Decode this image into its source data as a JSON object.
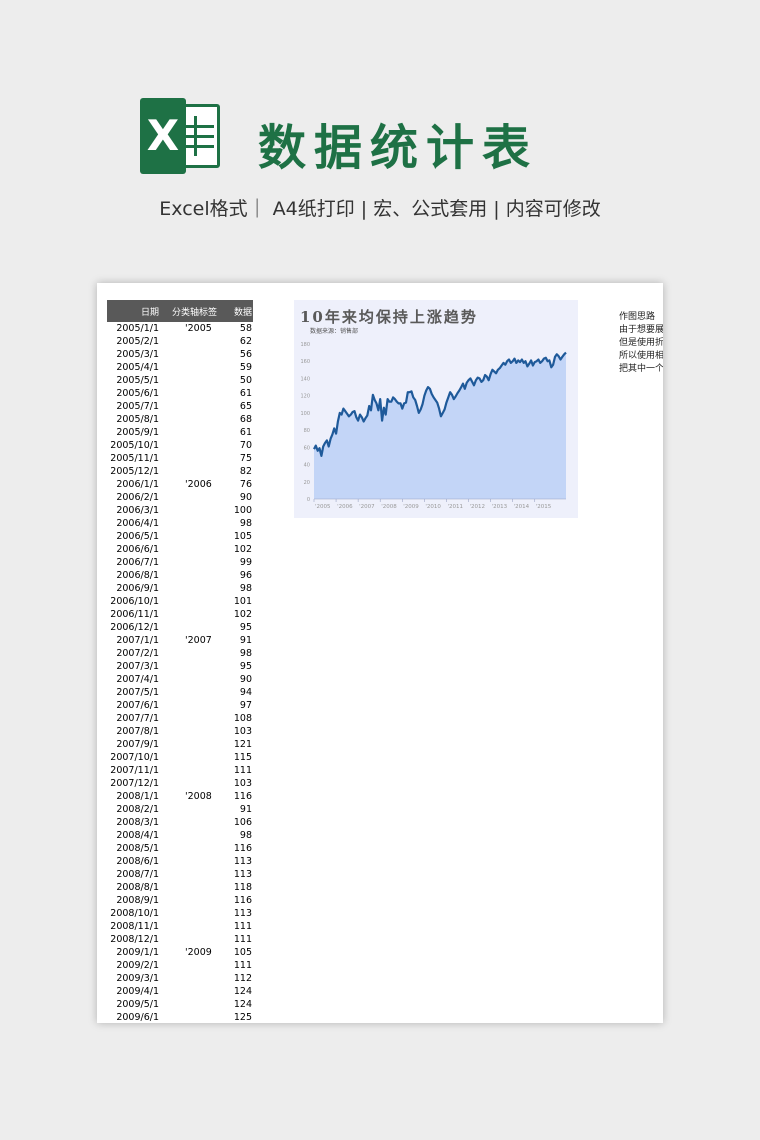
{
  "header": {
    "logo_letter": "X",
    "title": "数据统计表",
    "subtitle": "Excel格式｜ A4纸打印 | 宏、公式套用 | 内容可修改"
  },
  "table": {
    "headers": [
      "日期",
      "分类轴标签",
      "数据"
    ],
    "rows": [
      [
        "2005/1/1",
        "'2005",
        "58"
      ],
      [
        "2005/2/1",
        "",
        "62"
      ],
      [
        "2005/3/1",
        "",
        "56"
      ],
      [
        "2005/4/1",
        "",
        "59"
      ],
      [
        "2005/5/1",
        "",
        "50"
      ],
      [
        "2005/6/1",
        "",
        "61"
      ],
      [
        "2005/7/1",
        "",
        "65"
      ],
      [
        "2005/8/1",
        "",
        "68"
      ],
      [
        "2005/9/1",
        "",
        "61"
      ],
      [
        "2005/10/1",
        "",
        "70"
      ],
      [
        "2005/11/1",
        "",
        "75"
      ],
      [
        "2005/12/1",
        "",
        "82"
      ],
      [
        "2006/1/1",
        "'2006",
        "76"
      ],
      [
        "2006/2/1",
        "",
        "90"
      ],
      [
        "2006/3/1",
        "",
        "100"
      ],
      [
        "2006/4/1",
        "",
        "98"
      ],
      [
        "2006/5/1",
        "",
        "105"
      ],
      [
        "2006/6/1",
        "",
        "102"
      ],
      [
        "2006/7/1",
        "",
        "99"
      ],
      [
        "2006/8/1",
        "",
        "96"
      ],
      [
        "2006/9/1",
        "",
        "98"
      ],
      [
        "2006/10/1",
        "",
        "101"
      ],
      [
        "2006/11/1",
        "",
        "102"
      ],
      [
        "2006/12/1",
        "",
        "95"
      ],
      [
        "2007/1/1",
        "'2007",
        "91"
      ],
      [
        "2007/2/1",
        "",
        "98"
      ],
      [
        "2007/3/1",
        "",
        "95"
      ],
      [
        "2007/4/1",
        "",
        "90"
      ],
      [
        "2007/5/1",
        "",
        "94"
      ],
      [
        "2007/6/1",
        "",
        "97"
      ],
      [
        "2007/7/1",
        "",
        "108"
      ],
      [
        "2007/8/1",
        "",
        "103"
      ],
      [
        "2007/9/1",
        "",
        "121"
      ],
      [
        "2007/10/1",
        "",
        "115"
      ],
      [
        "2007/11/1",
        "",
        "111"
      ],
      [
        "2007/12/1",
        "",
        "103"
      ],
      [
        "2008/1/1",
        "'2008",
        "116"
      ],
      [
        "2008/2/1",
        "",
        "91"
      ],
      [
        "2008/3/1",
        "",
        "106"
      ],
      [
        "2008/4/1",
        "",
        "98"
      ],
      [
        "2008/5/1",
        "",
        "116"
      ],
      [
        "2008/6/1",
        "",
        "113"
      ],
      [
        "2008/7/1",
        "",
        "113"
      ],
      [
        "2008/8/1",
        "",
        "118"
      ],
      [
        "2008/9/1",
        "",
        "116"
      ],
      [
        "2008/10/1",
        "",
        "113"
      ],
      [
        "2008/11/1",
        "",
        "111"
      ],
      [
        "2008/12/1",
        "",
        "111"
      ],
      [
        "2009/1/1",
        "'2009",
        "105"
      ],
      [
        "2009/2/1",
        "",
        "111"
      ],
      [
        "2009/3/1",
        "",
        "112"
      ],
      [
        "2009/4/1",
        "",
        "124"
      ],
      [
        "2009/5/1",
        "",
        "124"
      ],
      [
        "2009/6/1",
        "",
        "125"
      ]
    ]
  },
  "chart": {
    "title": "10年来均保持上涨趋势",
    "source": "数据来源：销售部"
  },
  "chart_data": {
    "type": "area",
    "title": "10年来均保持上涨趋势",
    "subtitle": "数据来源：销售部",
    "x_tick_labels": [
      "2005",
      "2006",
      "2007",
      "2008",
      "2009",
      "2010",
      "2011",
      "2012",
      "2013",
      "2014",
      "2015"
    ],
    "ylim": [
      0,
      180
    ],
    "y_ticks": [
      0,
      20,
      40,
      60,
      80,
      100,
      120,
      140,
      160,
      180
    ],
    "colors": {
      "line": "#1f5a9a",
      "fill": "#c3d5f7"
    },
    "values": [
      58,
      62,
      56,
      59,
      50,
      61,
      65,
      68,
      61,
      70,
      75,
      82,
      76,
      90,
      100,
      98,
      105,
      102,
      99,
      96,
      98,
      101,
      102,
      95,
      91,
      98,
      95,
      90,
      94,
      97,
      108,
      103,
      121,
      115,
      111,
      103,
      116,
      91,
      106,
      98,
      116,
      113,
      113,
      118,
      116,
      113,
      111,
      111,
      105,
      111,
      112,
      124,
      124,
      125,
      118,
      115,
      108,
      100,
      104,
      110,
      120,
      126,
      130,
      128,
      122,
      118,
      115,
      112,
      105,
      96,
      100,
      104,
      112,
      118,
      124,
      121,
      116,
      119,
      123,
      126,
      130,
      134,
      128,
      135,
      138,
      140,
      136,
      132,
      138,
      141,
      140,
      136,
      138,
      144,
      142,
      138,
      145,
      150,
      148,
      146,
      150,
      152,
      155,
      158,
      156,
      160,
      162,
      158,
      160,
      163,
      158,
      161,
      159,
      162,
      158,
      160,
      154,
      157,
      161,
      155,
      159,
      160,
      162,
      158,
      160,
      163,
      164,
      160,
      161,
      153,
      156,
      165,
      168,
      166,
      162,
      165,
      168,
      170
    ]
  },
  "notes": {
    "lines": [
      "作图思路",
      "由于想要展",
      "但是使用折",
      "所以使用相",
      "把其中一个"
    ]
  }
}
